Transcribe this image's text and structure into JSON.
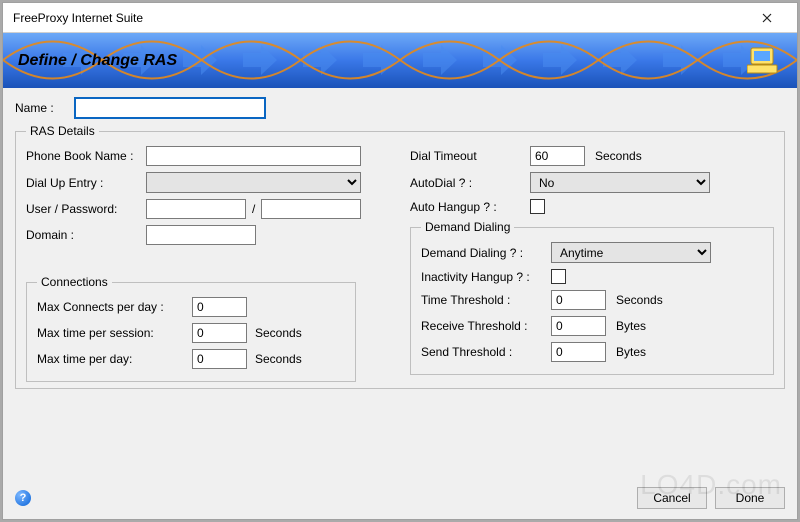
{
  "window": {
    "title": "FreeProxy Internet Suite"
  },
  "banner": {
    "title": "Define / Change RAS"
  },
  "name": {
    "label": "Name :",
    "value": ""
  },
  "ras": {
    "legend": "RAS Details",
    "phonebook": {
      "label": "Phone Book Name :",
      "value": ""
    },
    "dialup": {
      "label": "Dial Up Entry :",
      "selected": ""
    },
    "userpass": {
      "label": "User / Password:",
      "user": "",
      "sep": "/",
      "pass": ""
    },
    "domain": {
      "label": "Domain :",
      "value": ""
    },
    "dialtimeout": {
      "label": "Dial Timeout",
      "value": "60",
      "unit": "Seconds"
    },
    "autodial": {
      "label": "AutoDial ? :",
      "selected": "No"
    },
    "autohangup": {
      "label": "Auto Hangup ? :",
      "checked": false
    }
  },
  "demand": {
    "legend": "Demand Dialing",
    "demand": {
      "label": "Demand Dialing ? :",
      "selected": "Anytime"
    },
    "inactivity": {
      "label": "Inactivity Hangup ? :",
      "checked": false
    },
    "time": {
      "label": "Time Threshold :",
      "value": "0",
      "unit": "Seconds"
    },
    "receive": {
      "label": "Receive Threshold :",
      "value": "0",
      "unit": "Bytes"
    },
    "send": {
      "label": "Send Threshold :",
      "value": "0",
      "unit": "Bytes"
    }
  },
  "conn": {
    "legend": "Connections",
    "max_day": {
      "label": "Max Connects per day :",
      "value": "0"
    },
    "max_session": {
      "label": "Max time per session:",
      "value": "0",
      "unit": "Seconds"
    },
    "max_time_day": {
      "label": "Max time per day:",
      "value": "0",
      "unit": "Seconds"
    }
  },
  "buttons": {
    "cancel": "Cancel",
    "done": "Done"
  },
  "watermark": "LO4D.com"
}
